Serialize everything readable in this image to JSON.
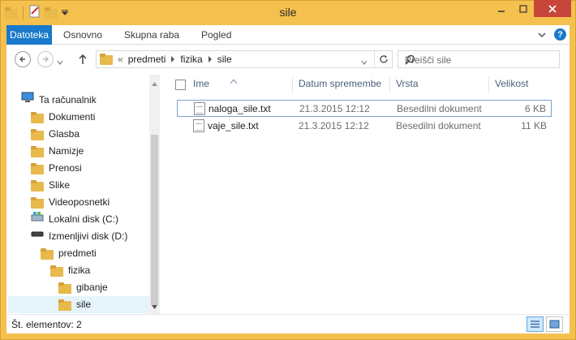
{
  "window": {
    "title": "sile"
  },
  "ribbon": {
    "tabs": [
      {
        "label": "Datoteka"
      },
      {
        "label": "Osnovno"
      },
      {
        "label": "Skupna raba"
      },
      {
        "label": "Pogled"
      }
    ],
    "help": "?"
  },
  "address": {
    "prefix": "«",
    "crumbs": [
      "predmeti",
      "fizika",
      "sile"
    ],
    "search_placeholder": "Preišči sile"
  },
  "nav": {
    "items": [
      {
        "label": "Ta računalnik",
        "icon": "computer-icon"
      },
      {
        "label": "Dokumenti",
        "icon": "documents-folder-icon"
      },
      {
        "label": "Glasba",
        "icon": "music-folder-icon"
      },
      {
        "label": "Namizje",
        "icon": "desktop-folder-icon"
      },
      {
        "label": "Prenosi",
        "icon": "downloads-folder-icon"
      },
      {
        "label": "Slike",
        "icon": "pictures-folder-icon"
      },
      {
        "label": "Videoposnetki",
        "icon": "videos-folder-icon"
      },
      {
        "label": "Lokalni disk (C:)",
        "icon": "local-disk-icon"
      },
      {
        "label": "Izmenljivi disk (D:)",
        "icon": "removable-disk-icon"
      },
      {
        "label": "predmeti",
        "icon": "folder-icon"
      },
      {
        "label": "fizika",
        "icon": "folder-icon"
      },
      {
        "label": "gibanje",
        "icon": "folder-icon"
      },
      {
        "label": "sile",
        "icon": "folder-icon"
      }
    ]
  },
  "files": {
    "headers": [
      "Ime",
      "Datum spremembe",
      "Vrsta",
      "Velikost"
    ],
    "rows": [
      {
        "name": "naloga_sile.txt",
        "date": "21.3.2015 12:12",
        "type": "Besedilni dokument",
        "size": "6 KB"
      },
      {
        "name": "vaje_sile.txt",
        "date": "21.3.2015 12:12",
        "type": "Besedilni dokument",
        "size": "11 KB"
      }
    ]
  },
  "status": {
    "text": "Št. elementov: 2"
  }
}
